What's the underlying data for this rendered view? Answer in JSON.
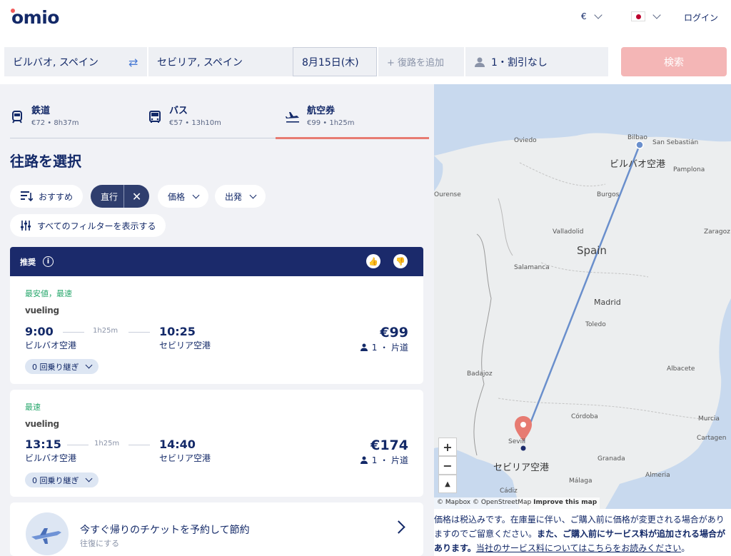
{
  "header": {
    "logo": "omio",
    "currency": "€",
    "login": "ログイン"
  },
  "search": {
    "from": "ビルバオ, スペイン",
    "to": "セビリア, スペイン",
    "date": "8月15日(木)",
    "return_placeholder": "+ 復路を追加",
    "passengers": "1・割引なし",
    "search_button": "検索"
  },
  "modes": [
    {
      "name": "鉄道",
      "sub": "€72 • 8h37m",
      "icon": "train-icon"
    },
    {
      "name": "バス",
      "sub": "€57 • 13h10m",
      "icon": "bus-icon"
    },
    {
      "name": "航空券",
      "sub": "€99 • 1h25m",
      "icon": "plane-icon"
    }
  ],
  "section_title": "往路を選択",
  "filters": {
    "recommend": "おすすめ",
    "direct": "直行",
    "price": "価格",
    "departure": "出発",
    "all_filters": "すべてのフィルターを表示する"
  },
  "recommended_label": "推奨",
  "results": [
    {
      "tag": "最安値，最速",
      "airline": "vueling",
      "dep_time": "9:00",
      "duration": "1h25m",
      "arr_time": "10:25",
      "dep_place": "ビルバオ空港",
      "arr_place": "セビリア空港",
      "price": "€99",
      "pax": "1 ・ 片道",
      "stops": "0 回乗り継ぎ"
    },
    {
      "tag": "最速",
      "airline": "vueling",
      "dep_time": "13:15",
      "duration": "1h25m",
      "arr_time": "14:40",
      "dep_place": "ビルバオ空港",
      "arr_place": "セビリア空港",
      "price": "€174",
      "pax": "1 ・ 片道",
      "stops": "0 回乗り継ぎ"
    }
  ],
  "return_promo": {
    "title": "今すぐ帰りのチケットを予約して節約",
    "sub": "往復にする"
  },
  "map": {
    "labels": {
      "oviedo": "Oviedo",
      "bilbao": "Bilbao",
      "san_sebastian": "San Sebastián",
      "pamplona": "Pamplona",
      "ourense": "Ourense",
      "burgos": "Burgos",
      "valladolid": "Valladolid",
      "zaragoza": "Zaragoz",
      "spain": "Spain",
      "salamanca": "Salamanca",
      "madrid": "Madrid",
      "toledo": "Toledo",
      "badajoz": "Badajoz",
      "albacete": "Albacete",
      "cordoba": "Córdoba",
      "murcia": "Murcia",
      "cartagena": "Cartagen",
      "seville": "Sevill",
      "granada": "Granada",
      "almeria": "Almeria",
      "malaga": "Málaga",
      "cadiz": "Cádiz"
    },
    "origin_airport": "ビルバオ空港",
    "dest_airport": "セビリア空港",
    "zoom_in": "+",
    "zoom_out": "−",
    "compass": "▲",
    "attribution": "© Mapbox © OpenStreetMap",
    "improve": "Improve this map"
  },
  "disclaimer": {
    "p1": "価格は税込みです。在庫量に伴い、ご購入前に価格が変更される場合がありますのでご留意ください。",
    "p2": "また、ご購入前にサービス料が追加される場合があります。",
    "link": "当社のサービス料についてはこちらをお読みください",
    "end": "。"
  }
}
